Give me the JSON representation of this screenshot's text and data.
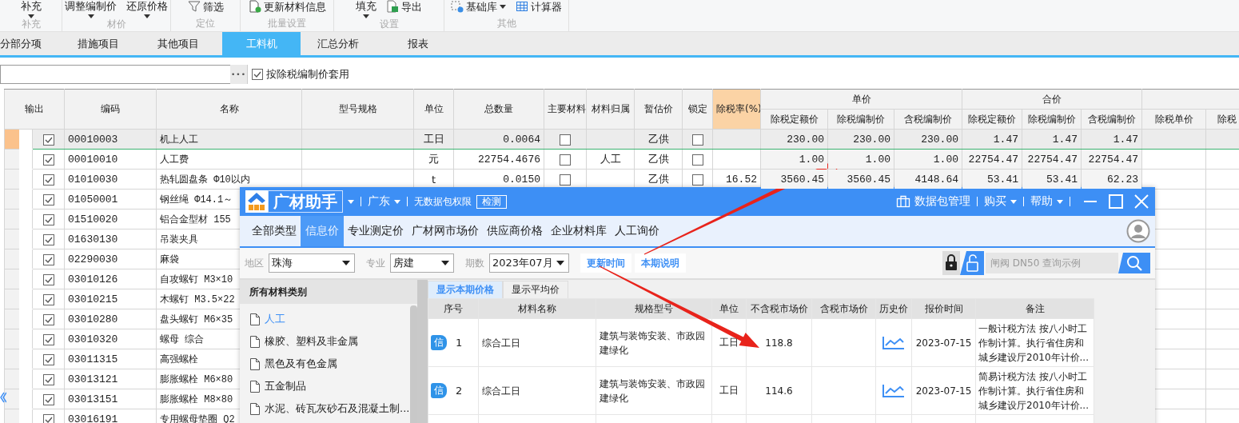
{
  "ribbon": {
    "groups": [
      {
        "label": "补充",
        "buttons": [
          {
            "label": "补充",
            "kind": "dropdown"
          }
        ]
      },
      {
        "label": "材价",
        "buttons": [
          {
            "label": "调整编制价",
            "kind": "dropdown"
          },
          {
            "label": "还原价格",
            "kind": "dropdown"
          }
        ]
      },
      {
        "label": "定位",
        "buttons": [
          {
            "label": "筛选",
            "kind": "filter"
          }
        ]
      },
      {
        "label": "批量设置",
        "buttons": [
          {
            "label": "更新材料信息",
            "kind": "update"
          }
        ]
      },
      {
        "label": "设置",
        "buttons": [
          {
            "label": "填充",
            "kind": "dropdown"
          },
          {
            "label": "导出",
            "kind": "export"
          }
        ]
      },
      {
        "label": "其他",
        "buttons": [
          {
            "label": "基础库",
            "kind": "library"
          },
          {
            "label": "计算器",
            "kind": "calculator"
          }
        ]
      }
    ]
  },
  "tabs": [
    {
      "label": "分部分项",
      "selected": false
    },
    {
      "label": "措施项目",
      "selected": false
    },
    {
      "label": "其他项目",
      "selected": false
    },
    {
      "label": "工料机",
      "selected": true
    },
    {
      "label": "汇总分析",
      "selected": false
    },
    {
      "label": "报表",
      "selected": false
    }
  ],
  "filter": {
    "more_button": "•••",
    "option": {
      "label": "按除税编制价套用",
      "checked": true
    }
  },
  "table": {
    "header": [
      {
        "label": "输出"
      },
      {
        "label": "编码"
      },
      {
        "label": "名称"
      },
      {
        "label": "型号规格"
      },
      {
        "label": "单位"
      },
      {
        "label": "总数量"
      },
      {
        "label": "主要材料"
      },
      {
        "label": "材料归属"
      },
      {
        "label": "暂估价"
      },
      {
        "label": "锁定"
      },
      {
        "label": "除税率(%)",
        "kind": "highlight"
      },
      {
        "label": "单价",
        "sub": [
          "除税定额价",
          "除税编制价",
          "含税编制价"
        ]
      },
      {
        "label": "合价",
        "sub": [
          "除税定额价",
          "除税编制价",
          "含税编制价"
        ]
      },
      {
        "sub": [
          "除税单价",
          "除税"
        ]
      }
    ],
    "rows": [
      {
        "selected": true,
        "output": true,
        "code": "00010003",
        "name": "机上人工",
        "unit": "工日",
        "quantity": "0.0064",
        "main_material": false,
        "estimate": "乙供",
        "locked": false,
        "prices": [
          "230.00",
          "230.00",
          "230.00",
          "1.47",
          "1.47",
          "1.47"
        ]
      },
      {
        "selected": false,
        "output": true,
        "code": "00010010",
        "name": "人工费",
        "unit": "元",
        "quantity": "22754.4676",
        "main_material": false,
        "owner": "人工",
        "estimate": "乙供",
        "locked": false,
        "prices": [
          "1.00",
          "1.00",
          "1.00",
          "22754.47",
          "22754.47",
          "22754.47"
        ]
      },
      {
        "selected": false,
        "output": true,
        "code": "01010030",
        "name": "热轧圆盘条 Φ10以内",
        "unit": "t",
        "quantity": "0.0150",
        "main_material": false,
        "estimate": "乙供",
        "locked": false,
        "tax_rate": "16.52",
        "prices": [
          "3560.45",
          "3560.45",
          "4148.64",
          "53.41",
          "53.41",
          "62.23"
        ]
      },
      {
        "selected": false,
        "output": true,
        "code": "01050001",
        "name": "钢丝绳 Φ14.1～"
      },
      {
        "selected": false,
        "output": true,
        "code": "01510020",
        "name": "铝合金型材 155"
      },
      {
        "selected": false,
        "output": true,
        "code": "01630130",
        "name": "吊装夹具"
      },
      {
        "selected": false,
        "output": true,
        "code": "02290030",
        "name": "麻袋"
      },
      {
        "selected": false,
        "output": true,
        "code": "03010126",
        "name": "自攻螺钉 M3×10"
      },
      {
        "selected": false,
        "output": true,
        "code": "03010215",
        "name": "木螺钉 M3.5×22"
      },
      {
        "selected": false,
        "output": true,
        "code": "03010280",
        "name": "盘头螺钉 M6×35"
      },
      {
        "selected": false,
        "output": true,
        "code": "03010320",
        "name": "螺母 综合"
      },
      {
        "selected": false,
        "output": true,
        "code": "03011315",
        "name": "高强螺栓"
      },
      {
        "selected": false,
        "output": true,
        "code": "03013121",
        "name": "膨胀螺栓 M6×80"
      },
      {
        "selected": false,
        "output": true,
        "code": "03013151",
        "name": "膨胀螺栓 M8×80"
      },
      {
        "selected": false,
        "output": true,
        "code": "03016191",
        "name": "专用螺母垫圈 Q2"
      }
    ]
  },
  "dialog": {
    "brand": "广材助手",
    "region": "广东",
    "permission": "无数据包权限",
    "check_button": "检测",
    "menu": [
      {
        "label": "数据包管理",
        "kind": "package"
      },
      {
        "label": "购买",
        "kind": "dropdown"
      },
      {
        "label": "帮助",
        "kind": "dropdown"
      }
    ],
    "tabs": [
      {
        "label": "全部类型",
        "selected": false
      },
      {
        "label": "信息价",
        "selected": true
      },
      {
        "label": "专业测定价",
        "selected": false
      },
      {
        "label": "广材网市场价",
        "selected": false
      },
      {
        "label": "供应商价格",
        "selected": false
      },
      {
        "label": "企业材料库",
        "selected": false
      },
      {
        "label": "人工询价",
        "selected": false
      }
    ],
    "filters": [
      {
        "label": "地区",
        "value": "珠海"
      },
      {
        "label": "专业",
        "value": "房建"
      },
      {
        "label": "期数",
        "value": "2023年07月"
      }
    ],
    "links": [
      "更新时间",
      "本期说明"
    ],
    "search": {
      "placeholder": "闸阀 DN50 查询示例"
    },
    "categories": {
      "title": "所有材料类别",
      "items": [
        {
          "label": "人工",
          "selected": true
        },
        {
          "label": "橡胶、塑料及非金属",
          "selected": false
        },
        {
          "label": "黑色及有色金属",
          "selected": false
        },
        {
          "label": "五金制品",
          "selected": false
        },
        {
          "label": "水泥、砖瓦灰砂石及混凝土制...",
          "selected": false
        }
      ]
    },
    "view_tabs": [
      {
        "label": "显示本期价格",
        "selected": true
      },
      {
        "label": "显示平均价",
        "selected": false
      }
    ],
    "price_table": {
      "columns": [
        "序号",
        "材料名称",
        "规格型号",
        "单位",
        "不含税市场价",
        "含税市场价",
        "历史价",
        "报价时间",
        "备注"
      ],
      "rows": [
        {
          "badge": "信",
          "index": "1",
          "name": "综合工日",
          "spec": "建筑与装饰安装、市政园建绿化",
          "unit": "工日",
          "price_ex_tax": "118.8",
          "date": "2023-07-15",
          "note": "一般计税方法 按八小时工作制计算。执行省住房和城乡建设厅2010年计价..."
        },
        {
          "badge": "信",
          "index": "2",
          "name": "综合工日",
          "spec": "建筑与装饰安装、市政园建绿化",
          "unit": "工日",
          "price_ex_tax": "114.6",
          "date": "2023-07-15",
          "note": "简易计税方法 按八小时工作制计算。执行省住房和城乡建设厅2010年计价..."
        }
      ]
    }
  }
}
